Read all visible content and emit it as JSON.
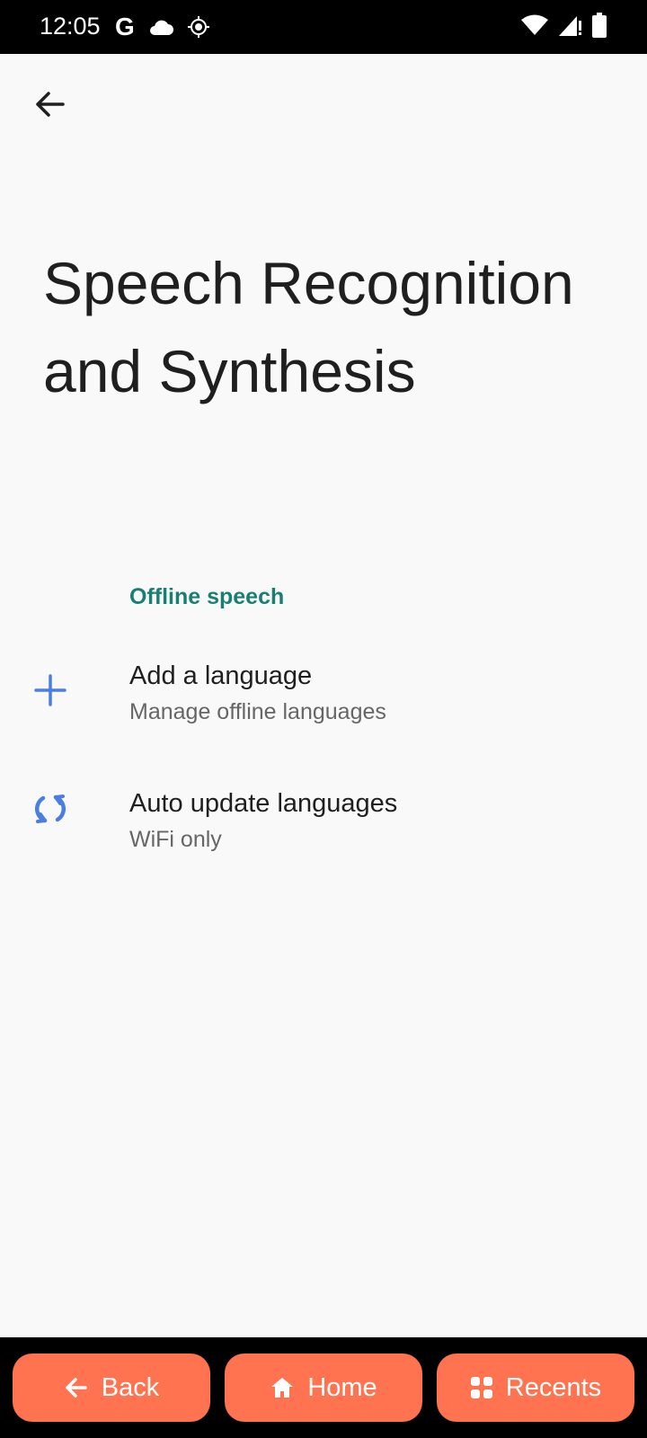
{
  "status_bar": {
    "time": "12:05",
    "google_letter": "G"
  },
  "page": {
    "title": "Speech Recognition and Synthesis"
  },
  "section": {
    "header": "Offline speech"
  },
  "items": [
    {
      "title": "Add a language",
      "summary": "Manage offline languages",
      "icon": "plus-icon"
    },
    {
      "title": "Auto update languages",
      "summary": "WiFi only",
      "icon": "sync-icon"
    }
  ],
  "nav": {
    "back": "Back",
    "home": "Home",
    "recents": "Recents"
  },
  "colors": {
    "accent": "#1a7f73",
    "icon_blue": "#4a7fe0",
    "nav_button": "#ff7350"
  }
}
